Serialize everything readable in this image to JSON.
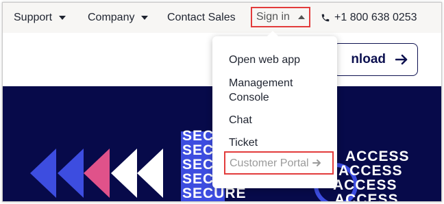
{
  "nav": {
    "support": "Support",
    "company": "Company",
    "contact_sales": "Contact Sales",
    "sign_in": "Sign in",
    "phone": "+1 800 638 0253"
  },
  "header": {
    "download_label": "nload"
  },
  "dropdown": {
    "items": [
      {
        "label": "Open web app"
      },
      {
        "label": "Management"
      },
      {
        "label": "Console"
      },
      {
        "label": "Chat"
      },
      {
        "label": "Ticket"
      },
      {
        "label": "Customer Portal"
      }
    ]
  },
  "hero": {
    "secure_words": [
      "SECURE",
      "SECURE",
      "SECURE",
      "SECURE",
      "SECURE"
    ],
    "access_words": [
      "ACCESS",
      "ACCESS",
      "ACCESS",
      "ACCESS"
    ]
  },
  "colors": {
    "highlight": "#e23b3b",
    "hero_bg": "#070a4a",
    "accent_blue": "#3d4de0",
    "accent_pink": "#e0528a"
  }
}
